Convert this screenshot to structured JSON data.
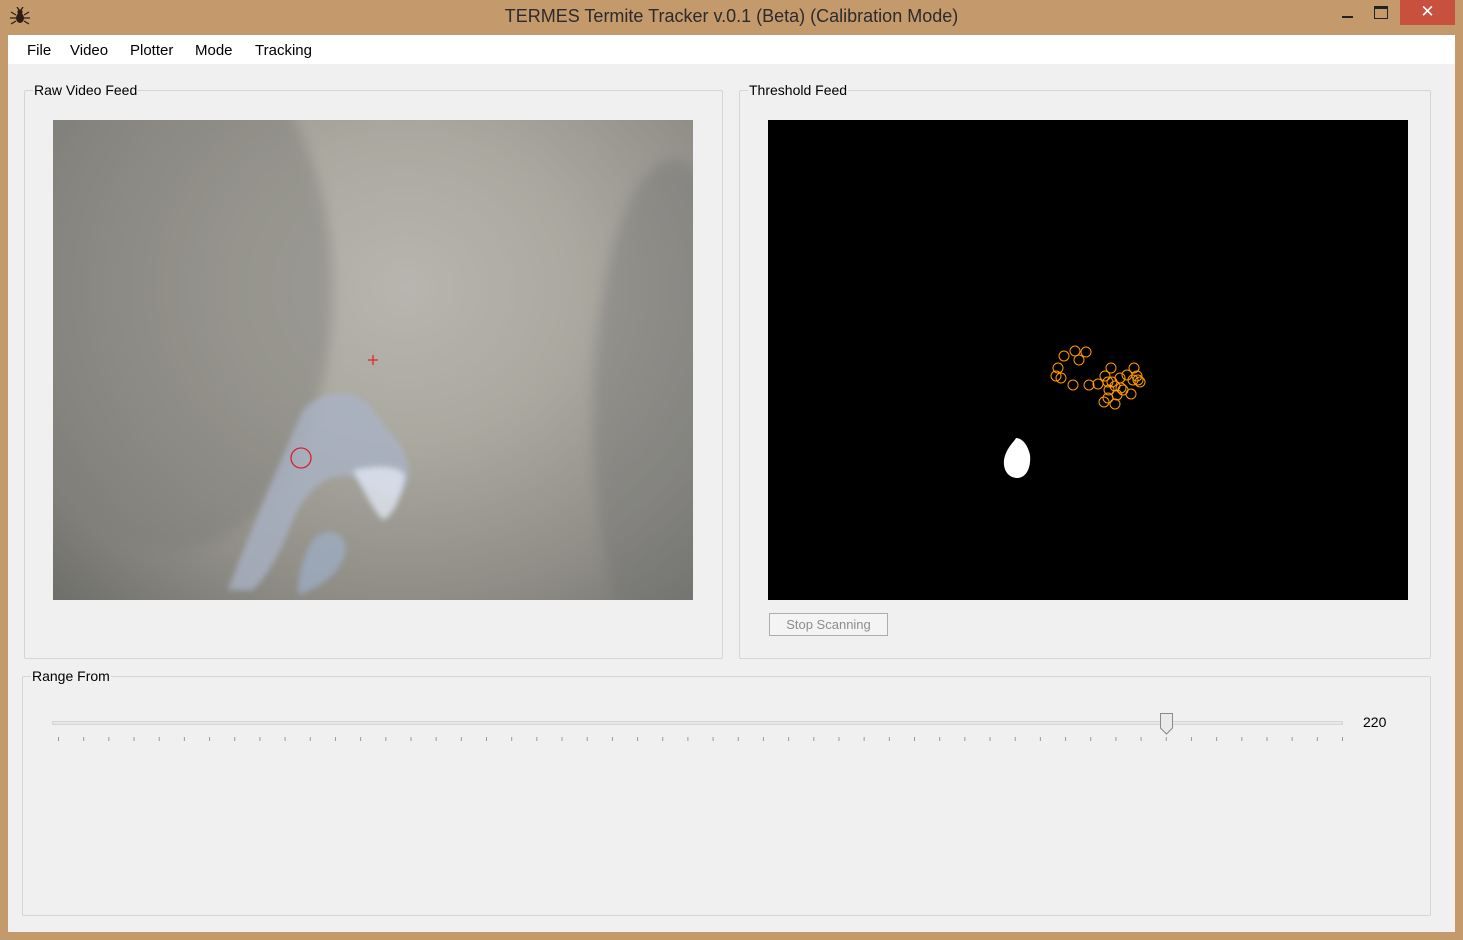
{
  "window": {
    "title": "TERMES Termite Tracker v.0.1 (Beta) (Calibration Mode)",
    "close_glyph": "✕",
    "app_icon": "termite-icon"
  },
  "menu": [
    "File",
    "Video",
    "Plotter",
    "Mode",
    "Tracking"
  ],
  "raw_feed": {
    "label": "Raw Video Feed",
    "crosshair_color": "#e0202a",
    "marker_color": "#d81f2a"
  },
  "threshold_feed": {
    "label": "Threshold Feed",
    "button_label": "Stop Scanning",
    "button_enabled": false,
    "track_marker_color": "#ff9a00"
  },
  "range": {
    "label": "Range From",
    "value": "220",
    "min": 0,
    "max": 255
  }
}
